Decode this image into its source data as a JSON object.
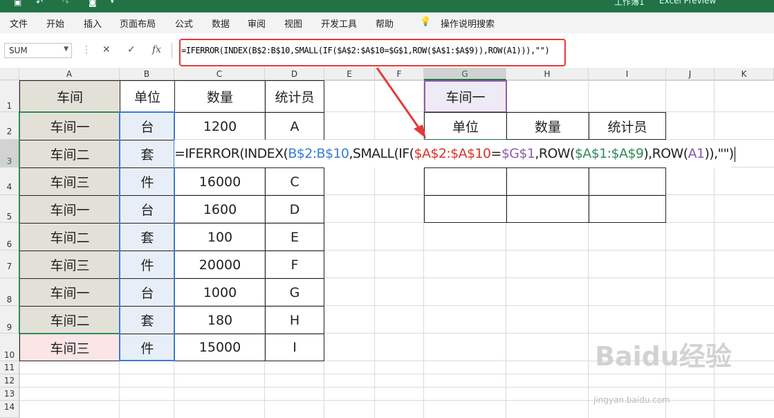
{
  "window": {
    "title_left": "工作簿1",
    "title_right": "Excel Preview"
  },
  "ribbon": {
    "tabs": [
      "文件",
      "开始",
      "插入",
      "页面布局",
      "公式",
      "数据",
      "审阅",
      "视图",
      "开发工具",
      "帮助"
    ],
    "tell_me": "操作说明搜索"
  },
  "formula_bar": {
    "name_box": "SUM",
    "fx": "fx",
    "formula": "=IFERROR(INDEX(B$2:B$10,SMALL(IF($A$2:$A$10=$G$1,ROW($A$1:$A$9)),ROW(A1))),\"\")"
  },
  "columns": [
    "A",
    "B",
    "C",
    "D",
    "E",
    "F",
    "G",
    "H",
    "I",
    "J",
    "K"
  ],
  "rows": [
    "1",
    "2",
    "3",
    "4",
    "5",
    "6",
    "7",
    "8",
    "9",
    "10",
    "11",
    "12",
    "13",
    "14"
  ],
  "table": {
    "headers": [
      "车间",
      "单位",
      "数量",
      "统计员"
    ],
    "rows": [
      [
        "车间一",
        "台",
        "1200",
        "A"
      ],
      [
        "车间二",
        "套",
        "",
        ""
      ],
      [
        "车间三",
        "件",
        "16000",
        "C"
      ],
      [
        "车间一",
        "台",
        "1600",
        "D"
      ],
      [
        "车间二",
        "套",
        "100",
        "E"
      ],
      [
        "车间三",
        "件",
        "20000",
        "F"
      ],
      [
        "车间一",
        "台",
        "1000",
        "G"
      ],
      [
        "车间二",
        "套",
        "180",
        "H"
      ],
      [
        "车间三",
        "件",
        "15000",
        "I"
      ]
    ]
  },
  "lookup": {
    "key": "车间一",
    "headers": [
      "单位",
      "数量",
      "统计员"
    ]
  },
  "cell_edit": {
    "p1": "=IFERROR(INDEX(",
    "p2": "B$2:B$10",
    "p3": ",SMALL(IF(",
    "p4": "$A$2:$A$10",
    "p5": "=",
    "p6": "$G$1",
    "p7": ",ROW(",
    "p8": "$A$1:$A$9",
    "p9": "),ROW(",
    "p10": "A1",
    "p11": ")),\"\")"
  },
  "watermark": {
    "brand": "Baidu经验",
    "url": "jingyan.baidu.com"
  },
  "colors": {
    "accent": "#217346",
    "highlight": "#e53935"
  }
}
